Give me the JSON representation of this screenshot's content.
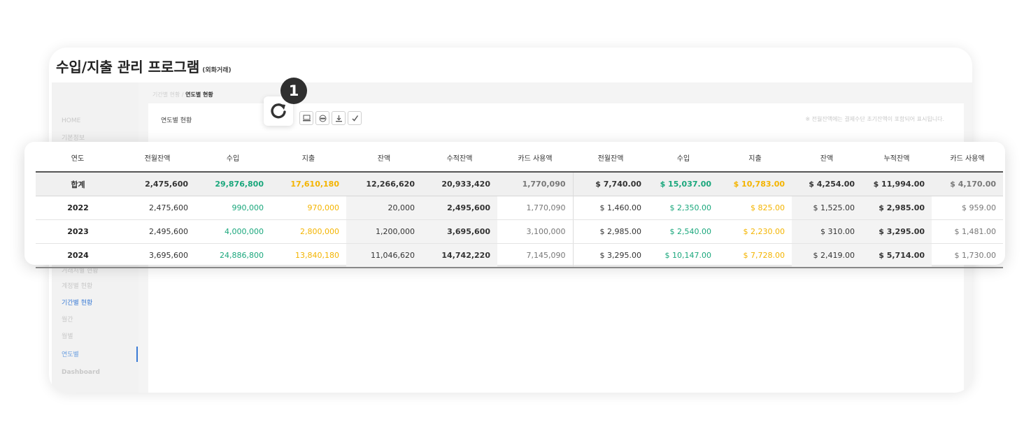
{
  "app": {
    "title": "수입/지출 관리 프로그램",
    "subtitle": "(외화거래)"
  },
  "breadcrumb": {
    "parent": "기간별 현황 /",
    "current": "연도별 현황"
  },
  "panel": {
    "title": "연도별 현황",
    "notice": "※ 전월잔액에는 결제수단 초기잔액이 포함되어 표시됩니다."
  },
  "sidebar": {
    "items": [
      {
        "label": "HOME"
      },
      {
        "label": "기본정보"
      },
      {
        "label": "거래처별 현황"
      },
      {
        "label": "계정별 현황"
      },
      {
        "label": "기간별 현황"
      },
      {
        "label": "월간"
      },
      {
        "label": "월별"
      },
      {
        "label": "연도별"
      },
      {
        "label": "Dashboard"
      }
    ]
  },
  "toolbar": {
    "icons": [
      "refresh-icon",
      "monitor-icon",
      "print-icon",
      "download-icon",
      "check-icon"
    ]
  },
  "callout": {
    "number": "1"
  },
  "colors": {
    "income": "#1aa77c",
    "expense": "#f4b400",
    "active": "#3a7bd5"
  },
  "table": {
    "headers": [
      "연도",
      "전월잔액",
      "수입",
      "지출",
      "잔액",
      "수적잔액",
      "카드 사용액",
      "전월잔액",
      "수입",
      "지출",
      "잔액",
      "누적잔액",
      "카드 사용액"
    ],
    "rows": [
      {
        "year": "합계",
        "cells": [
          "2,475,600",
          "29,876,800",
          "17,610,180",
          "12,266,620",
          "20,933,420",
          "1,770,090",
          "$ 7,740.00",
          "$ 15,037.00",
          "$ 10,783.00",
          "$ 4,254.00",
          "$ 11,994.00",
          "$ 4,170.00"
        ]
      },
      {
        "year": "2022",
        "cells": [
          "2,475,600",
          "990,000",
          "970,000",
          "20,000",
          "2,495,600",
          "1,770,090",
          "$ 1,460.00",
          "$ 2,350.00",
          "$ 825.00",
          "$ 1,525.00",
          "$ 2,985.00",
          "$ 959.00"
        ]
      },
      {
        "year": "2023",
        "cells": [
          "2,495,600",
          "4,000,000",
          "2,800,000",
          "1,200,000",
          "3,695,600",
          "3,100,000",
          "$ 2,985.00",
          "$ 2,540.00",
          "$ 2,230.00",
          "$ 310.00",
          "$ 3,295.00",
          "$ 1,481.00"
        ]
      },
      {
        "year": "2024",
        "cells": [
          "3,695,600",
          "24,886,800",
          "13,840,180",
          "11,046,620",
          "14,742,220",
          "7,145,090",
          "$ 3,295.00",
          "$ 10,147.00",
          "$ 7,728.00",
          "$ 2,419.00",
          "$ 5,714.00",
          "$ 1,730.00"
        ]
      }
    ]
  }
}
